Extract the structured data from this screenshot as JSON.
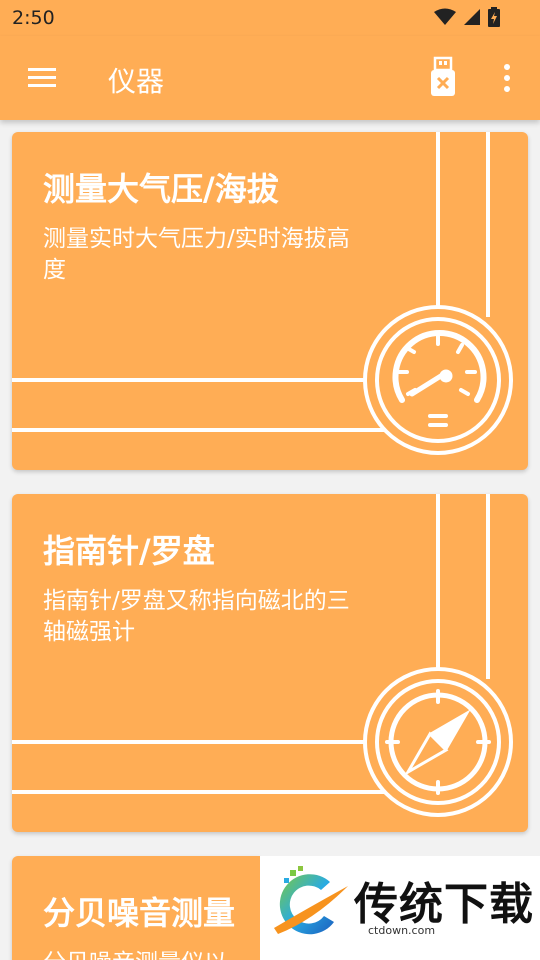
{
  "status_bar": {
    "time": "2:50"
  },
  "app_bar": {
    "title": "仪器"
  },
  "cards": [
    {
      "title": "测量大气压/海拔",
      "description": "测量实时大气压力/实时海拔高度",
      "icon": "gauge-icon"
    },
    {
      "title": "指南针/罗盘",
      "description": "指南针/罗盘又称指向磁北的三轴磁强计",
      "icon": "compass-icon"
    },
    {
      "title": "分贝噪音测量",
      "description": "分贝噪音测量仪以"
    }
  ],
  "watermark": {
    "text": "传统下载",
    "url": "ctdown.com"
  },
  "colors": {
    "primary": "#ffad55",
    "background": "#f2f2f2",
    "text_light": "#ffffff"
  }
}
